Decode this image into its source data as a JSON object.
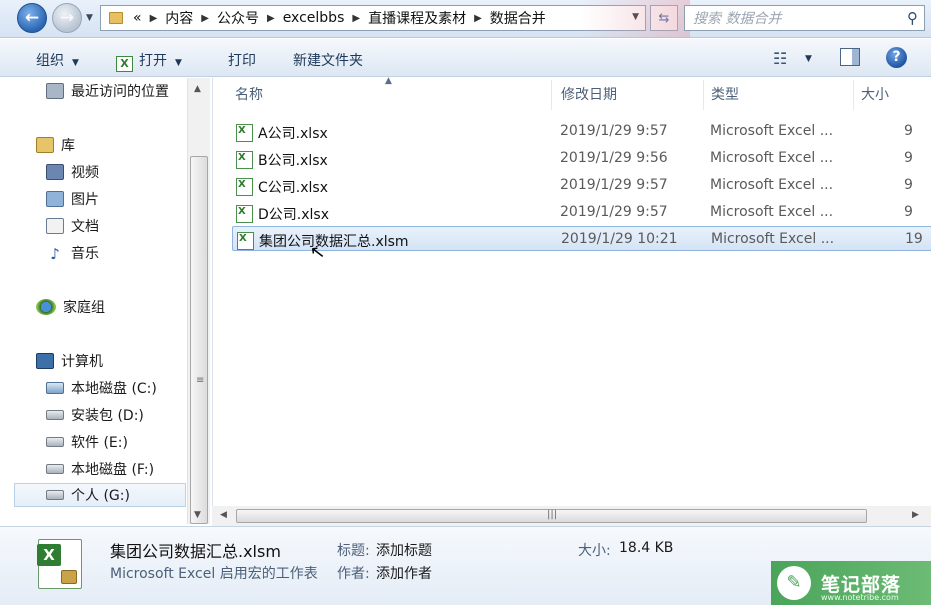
{
  "addressbar": {
    "breadcrumbs": [
      "«",
      "内容",
      "公众号",
      "excelbbs",
      "直播课程及素材",
      "数据合并"
    ],
    "search_placeholder": "搜索 数据合并"
  },
  "toolbar": {
    "organize": "组织",
    "open": "打开",
    "print": "打印",
    "new_folder": "新建文件夹"
  },
  "nav": {
    "items": [
      {
        "label": "最近访问的位置",
        "icon": "recent-places-icon"
      },
      {
        "label": "库",
        "icon": "library-icon"
      },
      {
        "label": "视频",
        "icon": "video-icon"
      },
      {
        "label": "图片",
        "icon": "pictures-icon"
      },
      {
        "label": "文档",
        "icon": "documents-icon"
      },
      {
        "label": "音乐",
        "icon": "music-icon"
      },
      {
        "label": "家庭组",
        "icon": "homegroup-icon"
      },
      {
        "label": "计算机",
        "icon": "computer-icon"
      },
      {
        "label": "本地磁盘 (C:)",
        "icon": "system-drive-icon"
      },
      {
        "label": "安装包 (D:)",
        "icon": "drive-icon"
      },
      {
        "label": "软件 (E:)",
        "icon": "drive-icon"
      },
      {
        "label": "本地磁盘 (F:)",
        "icon": "drive-icon"
      },
      {
        "label": "个人 (G:)",
        "icon": "drive-icon"
      }
    ]
  },
  "filelist": {
    "columns": [
      "名称",
      "修改日期",
      "类型",
      "大小"
    ],
    "rows": [
      {
        "name": "A公司.xlsx",
        "date": "2019/1/29 9:57",
        "type": "Microsoft Excel ...",
        "size": "9"
      },
      {
        "name": "B公司.xlsx",
        "date": "2019/1/29 9:56",
        "type": "Microsoft Excel ...",
        "size": "9"
      },
      {
        "name": "C公司.xlsx",
        "date": "2019/1/29 9:57",
        "type": "Microsoft Excel ...",
        "size": "9"
      },
      {
        "name": "D公司.xlsx",
        "date": "2019/1/29 9:57",
        "type": "Microsoft Excel ...",
        "size": "9"
      },
      {
        "name": "集团公司数据汇总.xlsm",
        "date": "2019/1/29 10:21",
        "type": "Microsoft Excel ...",
        "size": "19"
      }
    ]
  },
  "details": {
    "file_name": "集团公司数据汇总.xlsm",
    "file_type": "Microsoft Excel 启用宏的工作表",
    "title_label": "标题:",
    "title_value": "添加标题",
    "author_label": "作者:",
    "author_value": "添加作者",
    "size_label": "大小:",
    "size_value": "18.4 KB"
  },
  "watermark": {
    "text": "笔记部落",
    "sub": "www.notetribe.com"
  },
  "colors": {
    "selection": "#d3e3f5",
    "header_text": "#4c607a",
    "watermark_green": "#4aa45a"
  }
}
